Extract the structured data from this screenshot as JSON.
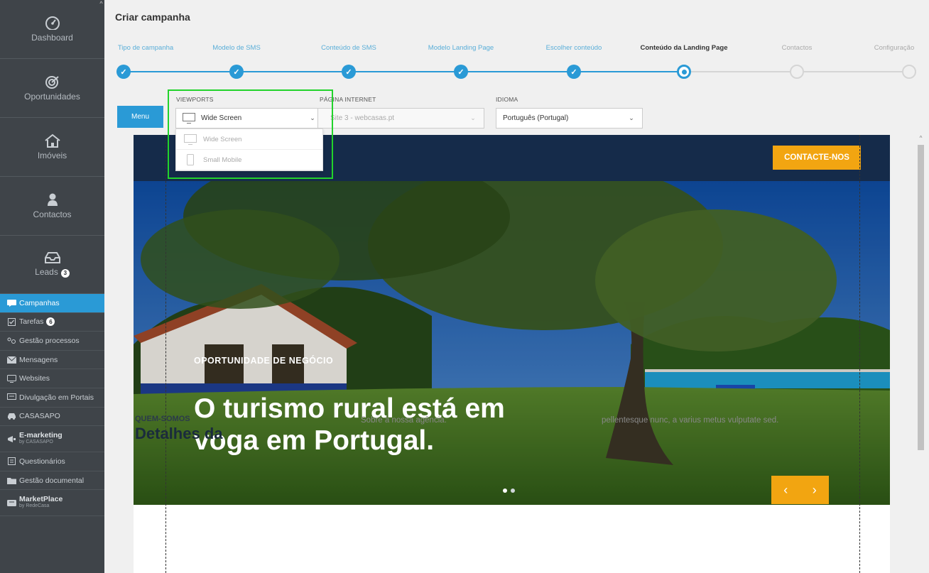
{
  "sidebar": {
    "big_items": [
      {
        "label": "Dashboard",
        "icon": "dashboard-gauge-icon"
      },
      {
        "label": "Oportunidades",
        "icon": "target-icon"
      },
      {
        "label": "Imóveis",
        "icon": "house-icon"
      },
      {
        "label": "Contactos",
        "icon": "person-icon"
      },
      {
        "label": "Leads",
        "icon": "inbox-icon",
        "badge": "3"
      }
    ],
    "items": [
      {
        "label": "Campanhas",
        "icon": "campaign-icon",
        "active": true
      },
      {
        "label": "Tarefas",
        "icon": "checkbox-icon",
        "badge": "6"
      },
      {
        "label": "Gestão processos",
        "icon": "process-icon"
      },
      {
        "label": "Mensagens",
        "icon": "envelope-icon"
      },
      {
        "label": "Websites",
        "icon": "website-icon"
      },
      {
        "label": "Divulgação em Portais",
        "icon": "portal-icon"
      },
      {
        "label": "CASASAPO",
        "icon": "car-icon"
      },
      {
        "label": "E-marketing",
        "sublabel": "by CASASAPO",
        "icon": "megaphone-icon"
      },
      {
        "label": "Questionários",
        "icon": "survey-icon"
      },
      {
        "label": "Gestão documental",
        "icon": "folder-icon"
      },
      {
        "label": "MarketPlace",
        "sublabel": "by RedeCasa",
        "icon": "marketplace-icon"
      }
    ]
  },
  "header": {
    "title": "Criar campanha"
  },
  "steps": [
    {
      "label": "Tipo de campanha",
      "state": "done"
    },
    {
      "label": "Modelo de SMS",
      "state": "done"
    },
    {
      "label": "Conteúdo de SMS",
      "state": "done"
    },
    {
      "label": "Modelo Landing Page",
      "state": "done"
    },
    {
      "label": "Escolher conteúdo",
      "state": "done"
    },
    {
      "label": "Conteúdo da Landing Page",
      "state": "current"
    },
    {
      "label": "Contactos",
      "state": "future"
    },
    {
      "label": "Configuração",
      "state": "future"
    }
  ],
  "toolbar": {
    "menu_label": "Menu",
    "viewports_label": "VIEWPORTS",
    "viewport_value": "Wide Screen",
    "pagina_label": "PÁGINA INTERNET",
    "pagina_value": "Site 3 - webcasas.pt",
    "idioma_label": "IDIOMA",
    "idioma_value": "Português (Portugal)"
  },
  "viewport_dropdown": {
    "options": [
      "Wide Screen",
      "Small Mobile"
    ]
  },
  "landing": {
    "contact_button": "CONTACTE-NOS",
    "hero_eyebrow": "OPORTUNIDADE DE NEGÓCIO",
    "hero_title": "O turismo rural está em voga em Portugal.",
    "arrow_prev": "‹",
    "arrow_next": "›",
    "slides_total": 2,
    "slide_active": 1,
    "about_eyebrow": "QUEM-SOMOS",
    "about_heading": "Detalhes da",
    "col2_text": "Sobre a nossa agência.",
    "col3_text": "pellentesque nunc, a varius metus vulputate sed."
  },
  "colors": {
    "accent": "#2a9ad6",
    "sidebar_bg": "#3f4449",
    "header_navy": "#152b4a",
    "cta_orange": "#f2a511",
    "highlight_green": "#22d32b"
  }
}
